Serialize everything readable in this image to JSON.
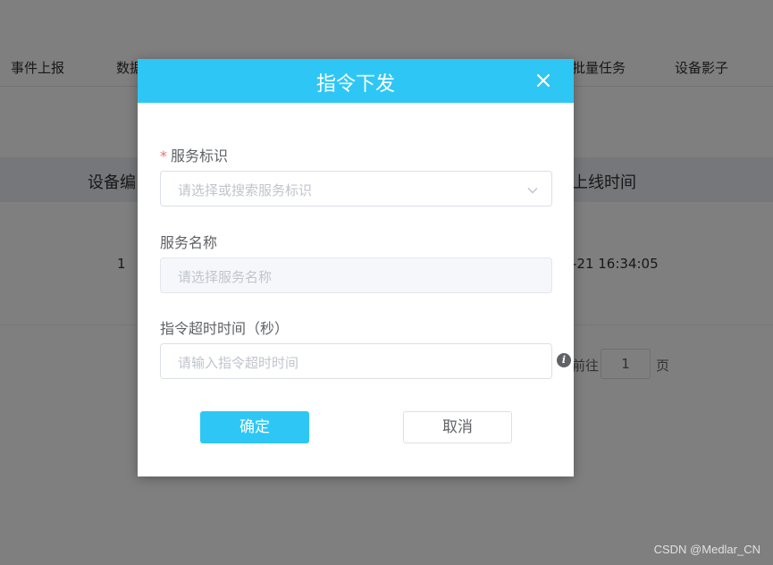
{
  "background": {
    "tabs": [
      "事件上报",
      "数据",
      "批量任务",
      "设备影子"
    ],
    "table_headers": [
      "设备编",
      "上线时间"
    ],
    "row": {
      "index": "1",
      "online_time": "-21 16:34:05"
    },
    "pager": {
      "goto": "前往",
      "page": "1",
      "unit": "页"
    }
  },
  "dialog": {
    "title": "指令下发",
    "fields": {
      "service_id": {
        "label": "服务标识",
        "required_mark": "*",
        "placeholder": "请选择或搜索服务标识"
      },
      "service_name": {
        "label": "服务名称",
        "placeholder": "请选择服务名称"
      },
      "timeout": {
        "label": "指令超时时间（秒）",
        "placeholder": "请输入指令超时时间"
      }
    },
    "buttons": {
      "confirm": "确定",
      "cancel": "取消"
    },
    "icons": {
      "close": "close-icon",
      "dropdown": "chevron-down-icon",
      "info": "info-icon"
    },
    "colors": {
      "accent": "#2ec7f5",
      "required": "#f56c6c"
    }
  },
  "watermark": "CSDN @Medlar_CN"
}
